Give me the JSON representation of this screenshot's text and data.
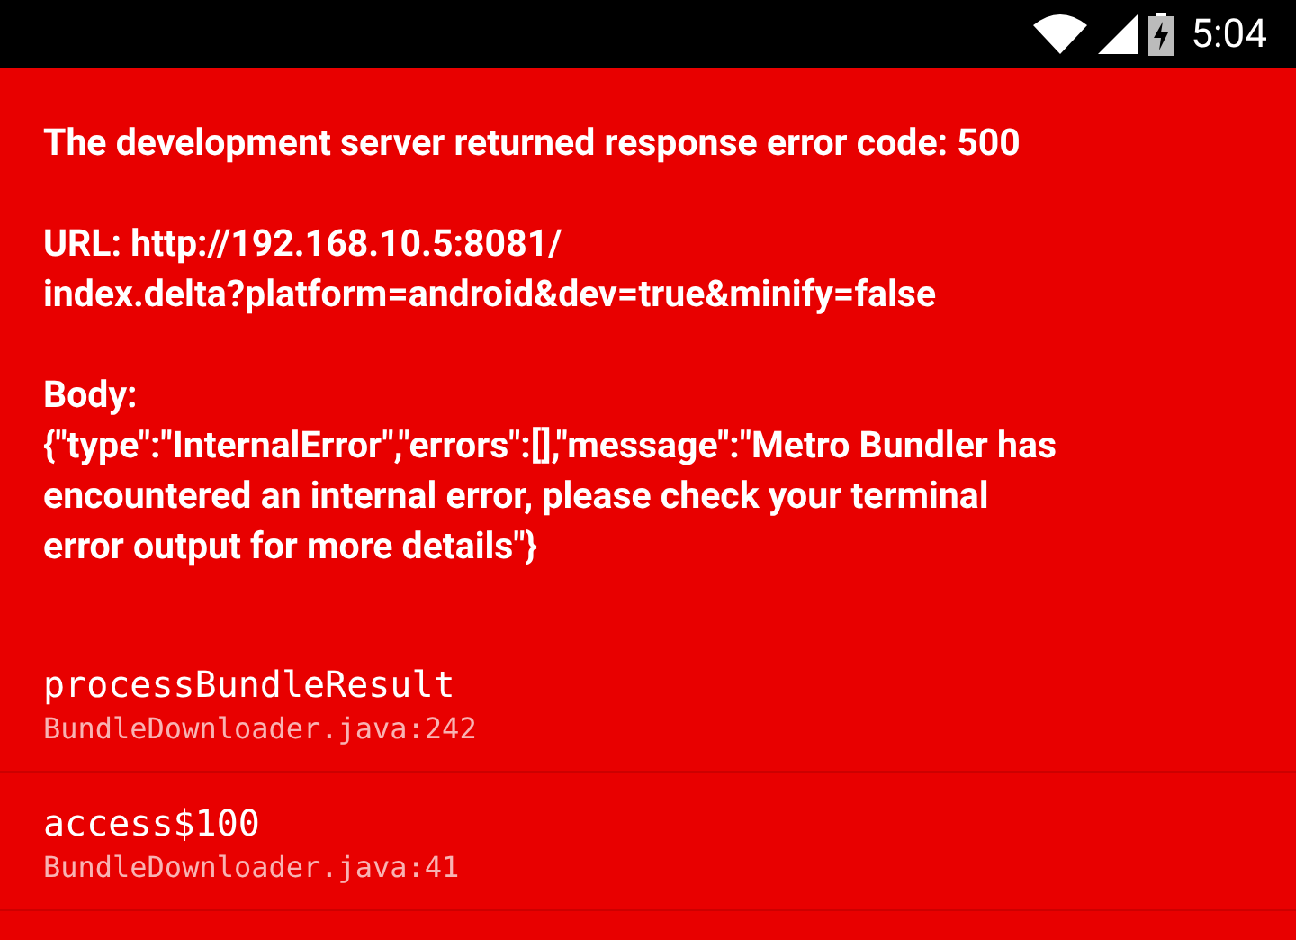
{
  "status_bar": {
    "time": "5:04"
  },
  "message": {
    "paragraphs": [
      [
        "The development server returned response error code: 500"
      ],
      [
        "URL: http://192.168.10.5:8081/",
        "index.delta?platform=android&dev=true&minify=false"
      ],
      [
        "Body:",
        "{\"type\":\"InternalError\",\"errors\":[],\"message\":\"Metro Bundler has",
        "encountered an internal error, please check your terminal",
        "error output for more details\"}"
      ]
    ]
  },
  "stack": [
    {
      "method": "processBundleResult",
      "location": "BundleDownloader.java:242"
    },
    {
      "method": "access$100",
      "location": "BundleDownloader.java:41"
    }
  ]
}
